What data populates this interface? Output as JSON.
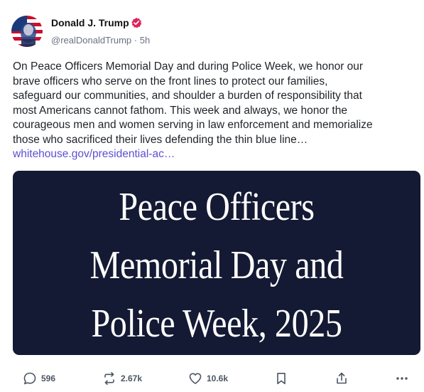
{
  "author": {
    "display_name": "Donald J. Trump",
    "handle": "@realDonaldTrump",
    "separator": "·",
    "time": "5h",
    "verified_icon": "verified-badge-icon",
    "verified_color": "#e0245e"
  },
  "post": {
    "lines": [
      "On Peace Officers Memorial Day and during Police Week, we honor our",
      "brave officers who serve on the front lines to protect our families,",
      "safeguard our communities, and shoulder a burden of responsibility that",
      "most Americans cannot fathom. This week and always, we honor the",
      "courageous men and women serving in law enforcement and memorialize",
      "those who sacrificed their lives defending the thin blue line…"
    ],
    "link_text": "whitehouse.gov/presidential-ac…",
    "link_color": "#5b4fd1"
  },
  "media": {
    "title_lines": [
      "Peace Officers",
      "Memorial Day and",
      "Police Week, 2025"
    ],
    "background": "#141a33"
  },
  "actions": {
    "replies": "596",
    "reposts": "2.67k",
    "likes": "10.6k",
    "icons": [
      "reply-icon",
      "repost-icon",
      "like-icon",
      "bookmark-icon",
      "share-icon",
      "more-icon"
    ]
  }
}
